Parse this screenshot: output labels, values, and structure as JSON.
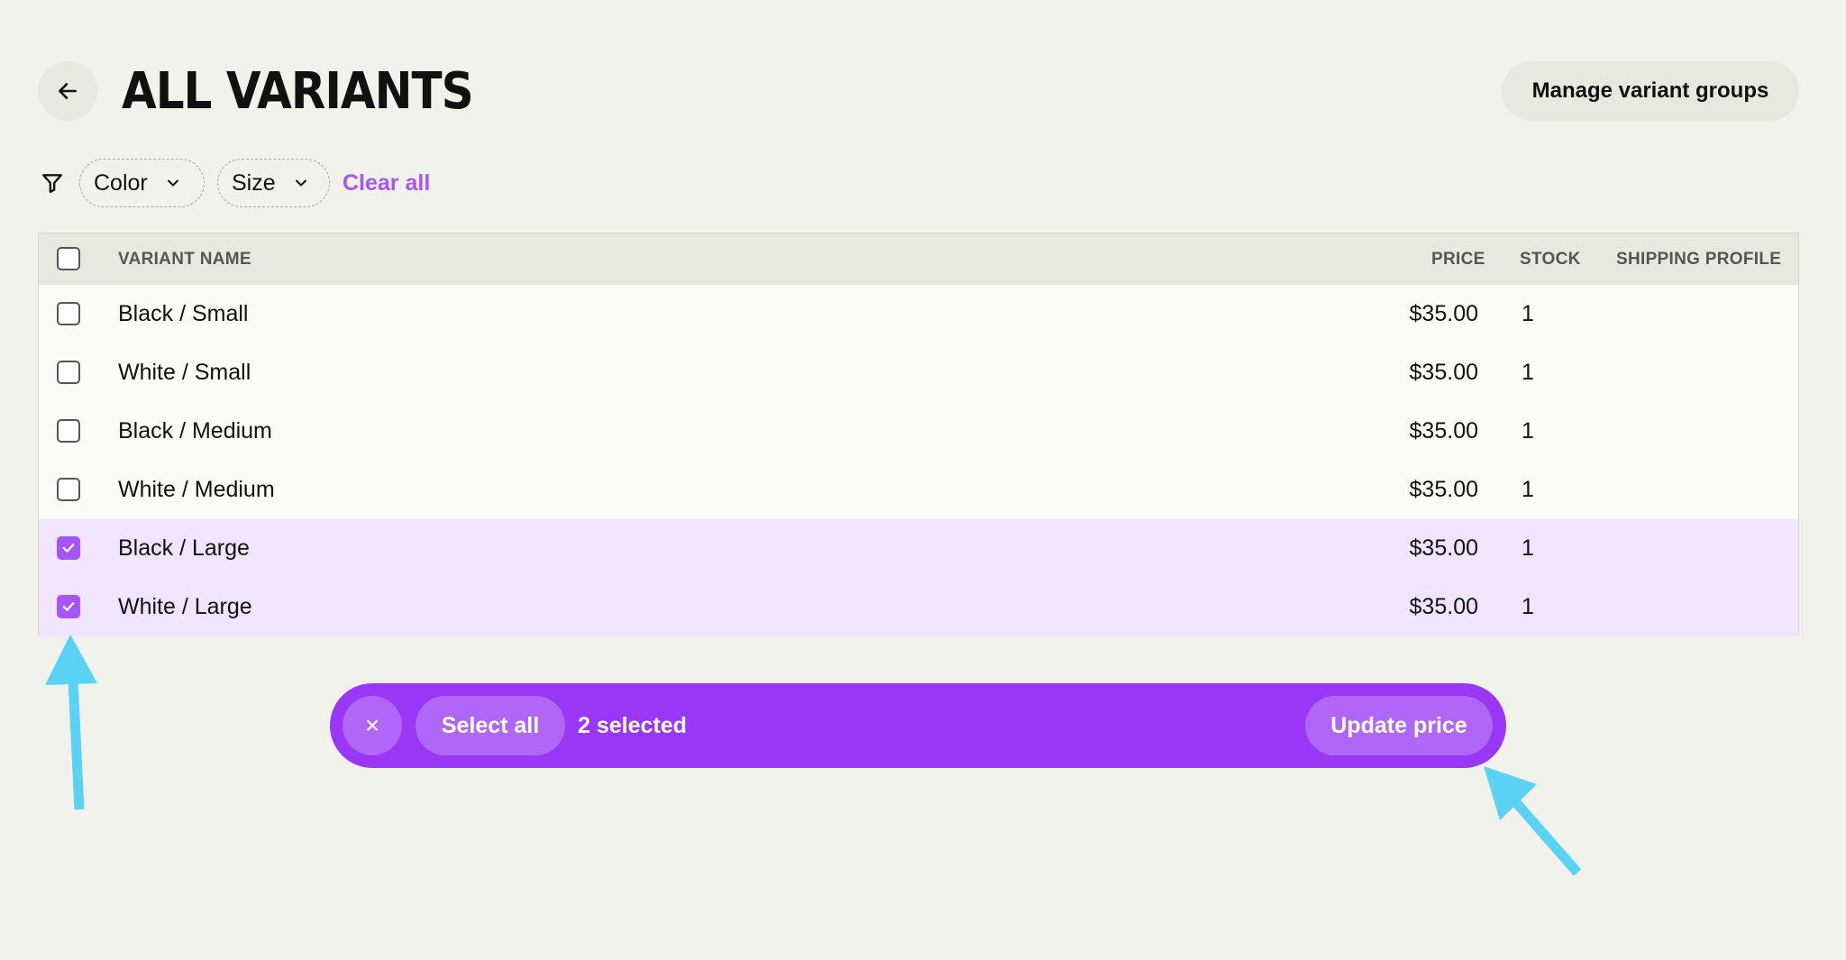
{
  "header": {
    "title": "ALL VARIANTS",
    "back_icon": "arrow-left-icon",
    "manage_button": "Manage variant groups"
  },
  "filters": {
    "icon": "filter-funnel-icon",
    "color_label": "Color",
    "size_label": "Size",
    "clear_all": "Clear all"
  },
  "table": {
    "columns": {
      "name": "VARIANT NAME",
      "price": "PRICE",
      "stock": "STOCK",
      "shipping": "SHIPPING PROFILE"
    },
    "rows": [
      {
        "name": "Black / Small",
        "price": "$35.00",
        "stock": "1",
        "checked": false
      },
      {
        "name": "White / Small",
        "price": "$35.00",
        "stock": "1",
        "checked": false
      },
      {
        "name": "Black / Medium",
        "price": "$35.00",
        "stock": "1",
        "checked": false
      },
      {
        "name": "White / Medium",
        "price": "$35.00",
        "stock": "1",
        "checked": false
      },
      {
        "name": "Black / Large",
        "price": "$35.00",
        "stock": "1",
        "checked": true
      },
      {
        "name": "White / Large",
        "price": "$35.00",
        "stock": "1",
        "checked": true
      }
    ]
  },
  "action_bar": {
    "close_glyph": "×",
    "select_all": "Select all",
    "selected_count": "2 selected",
    "update_price": "Update price"
  },
  "colors": {
    "accent": "#9a36f5",
    "checkbox": "#a855f7",
    "selected_row": "#f1e4fd",
    "annotation_arrow": "#5ad2f4"
  }
}
